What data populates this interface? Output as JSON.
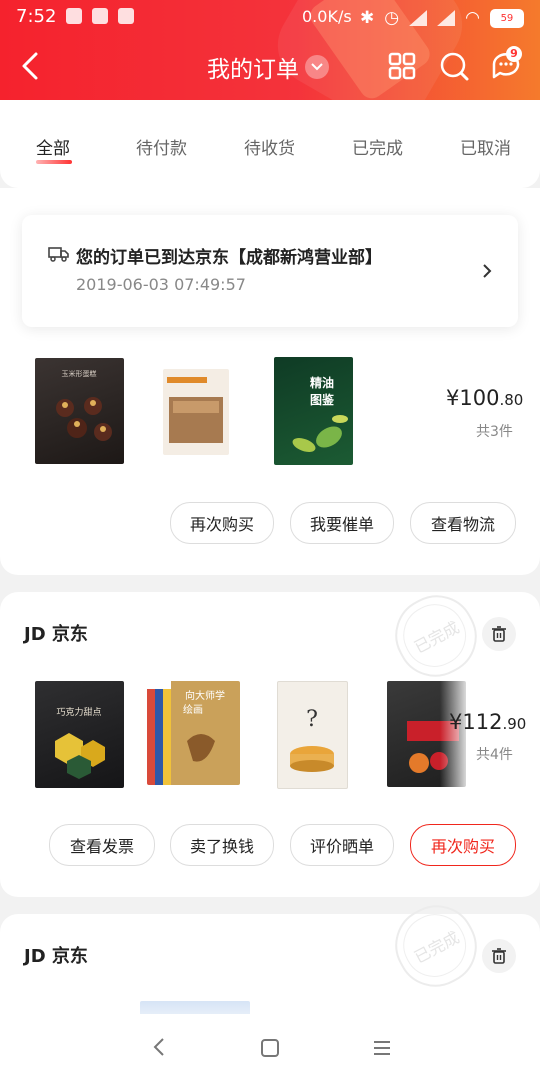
{
  "status_bar": {
    "time": "7:52",
    "network_speed": "0.0K/s",
    "battery": "59"
  },
  "header": {
    "title": "我的订单",
    "badge_count": "9"
  },
  "tabs": [
    {
      "label": "全部",
      "active": true
    },
    {
      "label": "待付款"
    },
    {
      "label": "待收货"
    },
    {
      "label": "已完成"
    },
    {
      "label": "已取消"
    }
  ],
  "orders": [
    {
      "notice_title": "您的订单已到达京东【成都新鸿营业部】",
      "notice_time": "2019-06-03 07:49:57",
      "price_int": "¥100",
      "price_dec": ".80",
      "count": "共3件",
      "buttons": [
        "再次购买",
        "我要催单",
        "查看物流"
      ]
    },
    {
      "shop": "JD 京东",
      "stamp": "已完成",
      "price_int": "¥112",
      "price_dec": ".90",
      "count": "共4件",
      "buttons": [
        "查看发票",
        "卖了换钱",
        "评价晒单",
        "再次购买"
      ]
    },
    {
      "shop": "JD 京东",
      "stamp": "已完成"
    }
  ],
  "colors": {
    "accent": "#f0271d",
    "header_start": "#f5222d",
    "header_end": "#f57a2c"
  }
}
